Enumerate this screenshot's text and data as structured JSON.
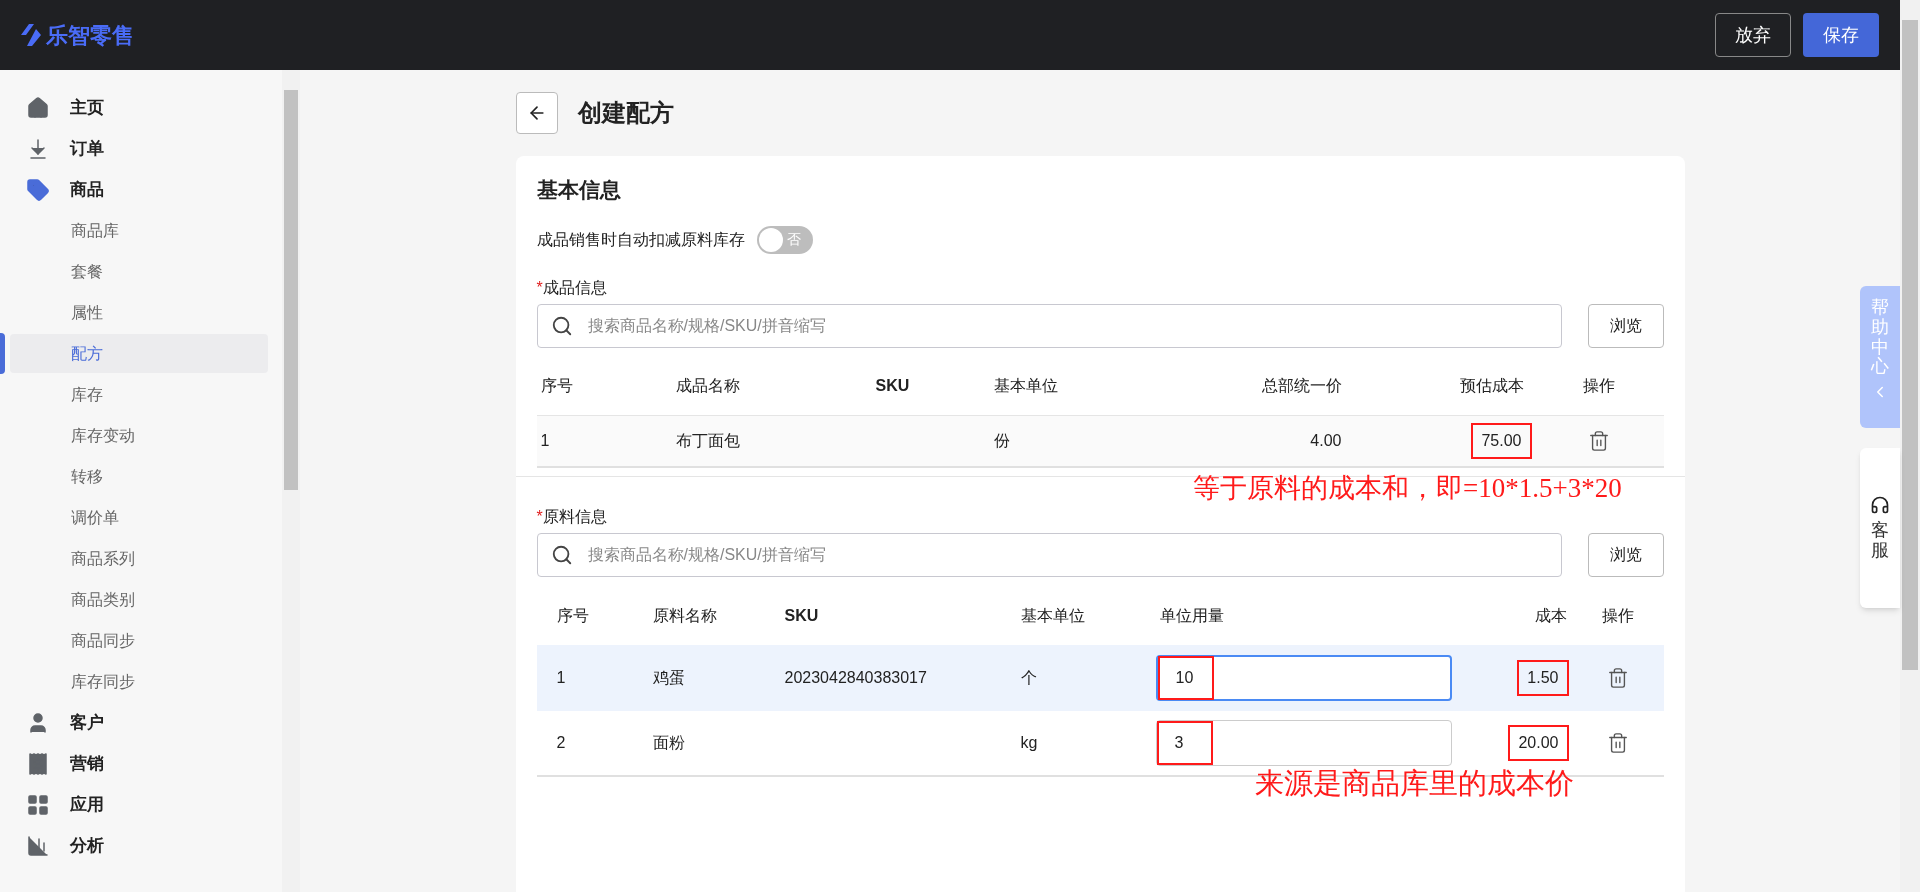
{
  "app": {
    "logo": "乐智零售"
  },
  "header_buttons": [
    {
      "label": "放弃",
      "kind": "secondary"
    },
    {
      "label": "保存",
      "kind": "primary"
    }
  ],
  "sidebar": {
    "items": [
      {
        "label": "主页",
        "selected": false
      },
      {
        "label": "订单",
        "selected": false
      },
      {
        "label": "商品",
        "selected": true,
        "children": [
          {
            "label": "商品库",
            "selected": false
          },
          {
            "label": "套餐",
            "selected": false
          },
          {
            "label": "属性",
            "selected": false
          },
          {
            "label": "配方",
            "selected": true
          },
          {
            "label": "库存",
            "selected": false
          },
          {
            "label": "库存变动",
            "selected": false
          },
          {
            "label": "转移",
            "selected": false
          },
          {
            "label": "调价单",
            "selected": false
          },
          {
            "label": "商品系列",
            "selected": false
          },
          {
            "label": "商品类别",
            "selected": false
          },
          {
            "label": "商品同步",
            "selected": false
          },
          {
            "label": "库存同步",
            "selected": false
          }
        ]
      },
      {
        "label": "客户",
        "selected": false
      },
      {
        "label": "营销",
        "selected": false
      },
      {
        "label": "应用",
        "selected": false
      },
      {
        "label": "分析",
        "selected": false
      }
    ]
  },
  "page": {
    "title": "创建配方"
  },
  "card": {
    "title": "基本信息",
    "auto_deduct": {
      "label": "成品销售时自动扣减原料库存",
      "on": false,
      "text": "否"
    },
    "product": {
      "label": "成品信息",
      "required_mark": "*",
      "search_placeholder": "搜索商品名称/规格/SKU/拼音缩写",
      "browse": "浏览",
      "columns": [
        "序号",
        "成品名称",
        "SKU",
        "基本单位",
        "总部统一价",
        "预估成本",
        "操作"
      ],
      "rows": [
        {
          "index": "1",
          "name": "布丁面包",
          "sku": "",
          "unit": "份",
          "price": "4.00",
          "cost": "75.00",
          "cost_highlighted": true
        }
      ]
    },
    "ingredients": {
      "label": "原料信息",
      "required_mark": "*",
      "search_placeholder": "搜索商品名称/规格/SKU/拼音缩写",
      "browse": "浏览",
      "columns": [
        "序号",
        "原料名称",
        "SKU",
        "基本单位",
        "单位用量",
        "成本",
        "操作"
      ],
      "rows": [
        {
          "index": "1",
          "name": "鸡蛋",
          "sku": "2023042840383017",
          "unit": "个",
          "amount": "10",
          "amount_highlighted": true,
          "focused": true,
          "cost": "1.50",
          "cost_highlighted": true
        },
        {
          "index": "2",
          "name": "面粉",
          "sku": "",
          "unit": "kg",
          "amount": "3",
          "amount_highlighted": true,
          "focused": false,
          "cost": "20.00",
          "cost_highlighted": true
        }
      ]
    }
  },
  "annotations": [
    {
      "text": "等于原料的成本和，即=10*1.5+3*20"
    },
    {
      "text": "来源是商品库里的成本价"
    }
  ],
  "help_tab": {
    "label": "帮助中心"
  },
  "service": {
    "label": "客服"
  }
}
